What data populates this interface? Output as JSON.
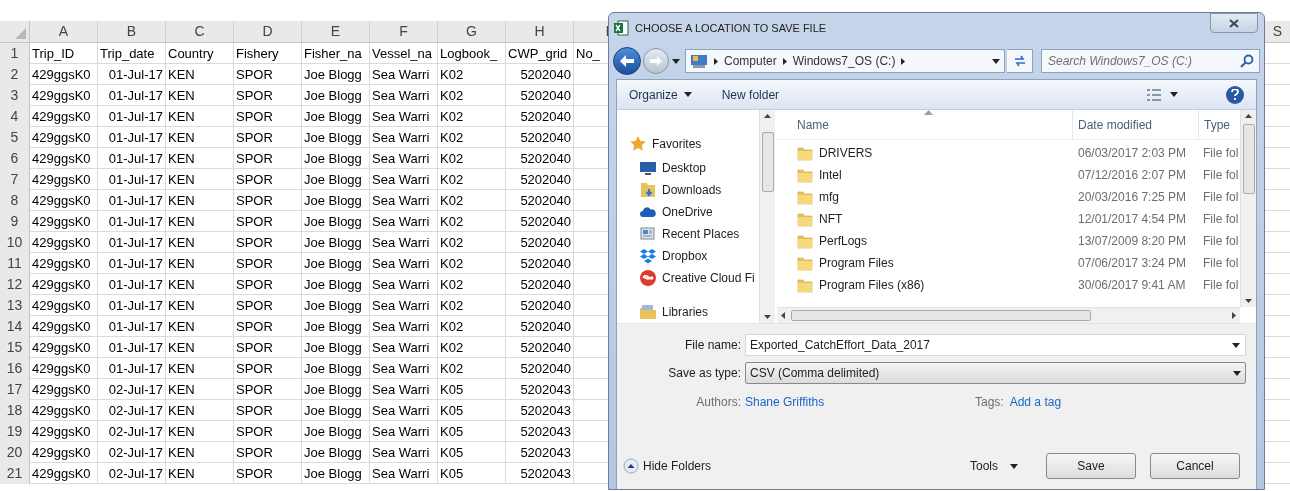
{
  "sheet": {
    "columns": [
      "A",
      "B",
      "C",
      "D",
      "E",
      "F",
      "G",
      "H",
      "I",
      "S"
    ],
    "rows": [
      {
        "number": "1",
        "cells": [
          "Trip_ID",
          "Trip_date",
          "Country",
          "Fishery",
          "Fisher_na",
          "Vessel_na",
          "Logbook_",
          "CWP_grid",
          "No_"
        ]
      },
      {
        "number": "2",
        "cells": [
          "429ggsK0",
          "01-Jul-17",
          "KEN",
          "SPOR",
          "Joe Blogg",
          "Sea Warri",
          "K02",
          "5202040"
        ]
      },
      {
        "number": "3",
        "cells": [
          "429ggsK0",
          "01-Jul-17",
          "KEN",
          "SPOR",
          "Joe Blogg",
          "Sea Warri",
          "K02",
          "5202040"
        ]
      },
      {
        "number": "4",
        "cells": [
          "429ggsK0",
          "01-Jul-17",
          "KEN",
          "SPOR",
          "Joe Blogg",
          "Sea Warri",
          "K02",
          "5202040"
        ]
      },
      {
        "number": "5",
        "cells": [
          "429ggsK0",
          "01-Jul-17",
          "KEN",
          "SPOR",
          "Joe Blogg",
          "Sea Warri",
          "K02",
          "5202040"
        ]
      },
      {
        "number": "6",
        "cells": [
          "429ggsK0",
          "01-Jul-17",
          "KEN",
          "SPOR",
          "Joe Blogg",
          "Sea Warri",
          "K02",
          "5202040"
        ]
      },
      {
        "number": "7",
        "cells": [
          "429ggsK0",
          "01-Jul-17",
          "KEN",
          "SPOR",
          "Joe Blogg",
          "Sea Warri",
          "K02",
          "5202040"
        ]
      },
      {
        "number": "8",
        "cells": [
          "429ggsK0",
          "01-Jul-17",
          "KEN",
          "SPOR",
          "Joe Blogg",
          "Sea Warri",
          "K02",
          "5202040"
        ]
      },
      {
        "number": "9",
        "cells": [
          "429ggsK0",
          "01-Jul-17",
          "KEN",
          "SPOR",
          "Joe Blogg",
          "Sea Warri",
          "K02",
          "5202040"
        ]
      },
      {
        "number": "10",
        "cells": [
          "429ggsK0",
          "01-Jul-17",
          "KEN",
          "SPOR",
          "Joe Blogg",
          "Sea Warri",
          "K02",
          "5202040"
        ]
      },
      {
        "number": "11",
        "cells": [
          "429ggsK0",
          "01-Jul-17",
          "KEN",
          "SPOR",
          "Joe Blogg",
          "Sea Warri",
          "K02",
          "5202040"
        ]
      },
      {
        "number": "12",
        "cells": [
          "429ggsK0",
          "01-Jul-17",
          "KEN",
          "SPOR",
          "Joe Blogg",
          "Sea Warri",
          "K02",
          "5202040"
        ]
      },
      {
        "number": "13",
        "cells": [
          "429ggsK0",
          "01-Jul-17",
          "KEN",
          "SPOR",
          "Joe Blogg",
          "Sea Warri",
          "K02",
          "5202040"
        ]
      },
      {
        "number": "14",
        "cells": [
          "429ggsK0",
          "01-Jul-17",
          "KEN",
          "SPOR",
          "Joe Blogg",
          "Sea Warri",
          "K02",
          "5202040"
        ]
      },
      {
        "number": "15",
        "cells": [
          "429ggsK0",
          "01-Jul-17",
          "KEN",
          "SPOR",
          "Joe Blogg",
          "Sea Warri",
          "K02",
          "5202040"
        ]
      },
      {
        "number": "16",
        "cells": [
          "429ggsK0",
          "01-Jul-17",
          "KEN",
          "SPOR",
          "Joe Blogg",
          "Sea Warri",
          "K02",
          "5202040"
        ]
      },
      {
        "number": "17",
        "cells": [
          "429ggsK0",
          "02-Jul-17",
          "KEN",
          "SPOR",
          "Joe Blogg",
          "Sea Warri",
          "K05",
          "5202043"
        ]
      },
      {
        "number": "18",
        "cells": [
          "429ggsK0",
          "02-Jul-17",
          "KEN",
          "SPOR",
          "Joe Blogg",
          "Sea Warri",
          "K05",
          "5202043"
        ]
      },
      {
        "number": "19",
        "cells": [
          "429ggsK0",
          "02-Jul-17",
          "KEN",
          "SPOR",
          "Joe Blogg",
          "Sea Warri",
          "K05",
          "5202043"
        ]
      },
      {
        "number": "20",
        "cells": [
          "429ggsK0",
          "02-Jul-17",
          "KEN",
          "SPOR",
          "Joe Blogg",
          "Sea Warri",
          "K05",
          "5202043"
        ]
      },
      {
        "number": "21",
        "cells": [
          "429ggsK0",
          "02-Jul-17",
          "KEN",
          "SPOR",
          "Joe Blogg",
          "Sea Warri",
          "K05",
          "5202043"
        ]
      }
    ]
  },
  "dialog": {
    "title": "CHOOSE A LOCATION TO SAVE FILE",
    "breadcrumb": [
      "Computer",
      "Windows7_OS (C:)"
    ],
    "search": {
      "placeholder": "Search Windows7_OS (C:)"
    },
    "toolbar": [
      "Organize",
      "New folder"
    ],
    "nav": [
      {
        "kind": "star",
        "label": "Favorites"
      },
      {
        "kind": "desktop",
        "label": "Desktop"
      },
      {
        "kind": "downloads",
        "label": "Downloads"
      },
      {
        "kind": "cloud",
        "label": "OneDrive"
      },
      {
        "kind": "recent",
        "label": "Recent Places"
      },
      {
        "kind": "dropbox",
        "label": "Dropbox"
      },
      {
        "kind": "creative",
        "label": "Creative Cloud Fi"
      },
      {
        "kind": "library",
        "label": "Libraries"
      }
    ],
    "columns": [
      "Name",
      "Date modified",
      "Type"
    ],
    "files": [
      {
        "name": "DRIVERS",
        "date": "06/03/2017 2:03 PM",
        "type": "File fol"
      },
      {
        "name": "Intel",
        "date": "07/12/2016 2:07 PM",
        "type": "File fol"
      },
      {
        "name": "mfg",
        "date": "20/03/2016 7:25 PM",
        "type": "File fol"
      },
      {
        "name": "NFT",
        "date": "12/01/2017 4:54 PM",
        "type": "File fol"
      },
      {
        "name": "PerfLogs",
        "date": "13/07/2009 8:20 PM",
        "type": "File fol"
      },
      {
        "name": "Program Files",
        "date": "07/06/2017 3:24 PM",
        "type": "File fol"
      },
      {
        "name": "Program Files (x86)",
        "date": "30/06/2017 9:41 AM",
        "type": "File fol"
      }
    ],
    "file_name": {
      "label": "File name:",
      "value": "Exported_CatchEffort_Data_2017"
    },
    "save_type": {
      "label": "Save as type:",
      "value": "CSV (Comma delimited)"
    },
    "authors": {
      "label": "Authors:",
      "value": "Shane Griffiths"
    },
    "tags": {
      "label": "Tags:",
      "value": "Add a tag"
    },
    "hide_folders": "Hide Folders",
    "tools": "Tools",
    "buttons": [
      "Save",
      "Cancel"
    ]
  }
}
